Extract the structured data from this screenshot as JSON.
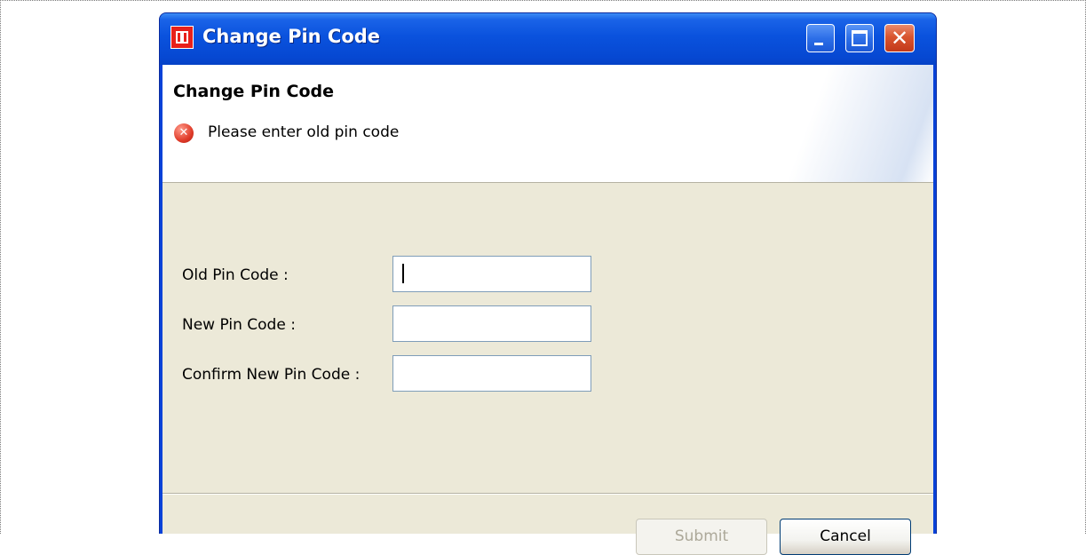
{
  "window": {
    "title": "Change Pin Code"
  },
  "header": {
    "title": "Change Pin Code",
    "error_message": "Please enter old pin code"
  },
  "form": {
    "old_pin_label": "Old Pin Code :",
    "new_pin_label": "New Pin Code :",
    "confirm_pin_label": "Confirm New Pin Code :",
    "old_pin_value": "",
    "new_pin_value": "",
    "confirm_pin_value": ""
  },
  "buttons": {
    "submit_label": "Submit",
    "submit_enabled": false,
    "cancel_label": "Cancel"
  },
  "colors": {
    "titlebar": "#0a52dd",
    "dialog_background": "#ece9d8",
    "error_icon": "#e03c2a",
    "close_button": "#d9552f"
  },
  "icons": {
    "app": "app-logo-icon",
    "error": "error-icon",
    "minimize": "minimize-icon",
    "maximize": "maximize-icon",
    "close": "close-icon"
  }
}
